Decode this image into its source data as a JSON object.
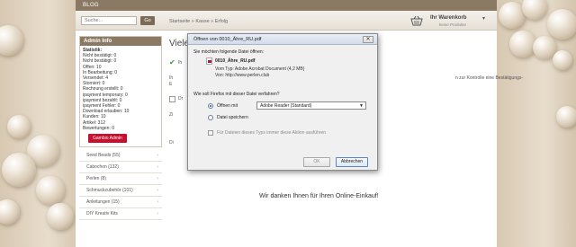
{
  "colors": {
    "topbar": "#8a7a63",
    "accent_red": "#c8102e",
    "page_bg": "#ffffff",
    "side_bg": "#d9ccb9"
  },
  "topbar": {
    "blog_label": "BLOG"
  },
  "header": {
    "search_placeholder": "Suche...",
    "go_label": "Go",
    "breadcrumb": "Startseite » Kasse » Erfolg",
    "cart_title": "Ihr Warenkorb",
    "cart_subtitle": "keine Produkte",
    "cart_chevron": "▾"
  },
  "admin": {
    "title": "Admin Info",
    "stat_heading": "Statistik:",
    "lines": [
      "Nicht bestätigt: 0",
      "Nicht bestätigt: 0",
      "Offen: 10",
      "In Bearbeitung: 0",
      "Versendet: 4",
      "Storniert: 0",
      "Rechnung erstellt: 0",
      "ipayment temporary: 0",
      "ipayment bezahlt: 0",
      "ipayment Fehler: 0",
      "Download erlauben: 10",
      "Kunden: 10",
      "Artikel: 312",
      "Bewertungen: 0"
    ],
    "button_label": "Gambio Admin"
  },
  "categories": [
    {
      "label": "Seed Beads (55)"
    },
    {
      "label": "Cabochon (132)"
    },
    {
      "label": "Perlen (8)"
    },
    {
      "label": "Schmuckzubehör (101)"
    },
    {
      "label": "Anleitungen (15)"
    },
    {
      "label": "DIY Kreativ Kits"
    }
  ],
  "main": {
    "title": "Viele",
    "frag1": "Ih",
    "frag2": "n zur Kontrolle eine Bestätigungs-",
    "frag_ir": "Ih",
    "frag_e": "E",
    "frag_dr": "Dr",
    "frag_z": "Zi",
    "frag_di": "Di",
    "thanks": "Wir danken Ihnen für Ihren Online-Einkauf!"
  },
  "dialog": {
    "title": "Öffnen von 0010_Ähre_RU.pdf",
    "close_glyph": "✕",
    "intro": "Sie möchten folgende Datei öffnen:",
    "file_name": "0010_Ähre_RU.pdf",
    "file_type": "Vom Typ:  Adobe Acrobat Document (4,2 MB)",
    "file_from": "Von:  http://www.perlen.club",
    "question": "Wie soll Firefox mit dieser Datei verfahren?",
    "open_with_label": "Öffnen mit",
    "open_with_app": "Adobe Reader  (Standard)",
    "save_label": "Datei speichern",
    "remember_label": "Für Dateien dieses Typs immer diese Aktion ausführen",
    "ok_label": "OK",
    "cancel_label": "Abbrechen"
  }
}
